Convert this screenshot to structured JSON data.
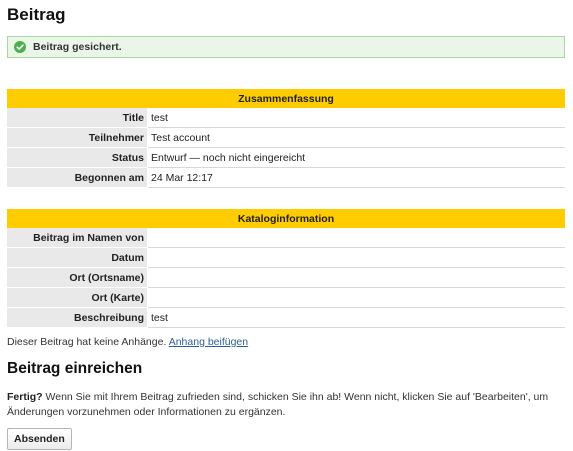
{
  "page": {
    "title": "Beitrag"
  },
  "notice": {
    "message": "Beitrag gesichert.",
    "icon": "check-circle-icon",
    "color": "#4caf50"
  },
  "summary": {
    "header": "Zusammenfassung",
    "rows": [
      {
        "label": "Title",
        "value": "test"
      },
      {
        "label": "Teilnehmer",
        "value": "Test account"
      },
      {
        "label": "Status",
        "value": "Entwurf — noch nicht eingereicht"
      },
      {
        "label": "Begonnen am",
        "value": "24 Mar 12:17"
      }
    ]
  },
  "catalog": {
    "header": "Kataloginformation",
    "rows": [
      {
        "label": "Beitrag im Namen von",
        "value": ""
      },
      {
        "label": "Datum",
        "value": ""
      },
      {
        "label": "Ort (Ortsname)",
        "value": ""
      },
      {
        "label": "Ort (Karte)",
        "value": ""
      },
      {
        "label": "Beschreibung",
        "value": "test"
      }
    ]
  },
  "attachments": {
    "text": "Dieser Beitrag hat keine Anhänge.",
    "link": "Anhang beifügen"
  },
  "submit": {
    "title": "Beitrag einreichen",
    "lead": "Fertig?",
    "text": " Wenn Sie mit Ihrem Beitrag zufrieden sind, schicken Sie ihn ab! Wenn nicht, klicken Sie auf 'Bearbeiten', um Änderungen vorzunehmen oder Informationen zu ergänzen.",
    "button_label": "Absenden"
  },
  "colors": {
    "accent": "#ffcc00",
    "label_bg": "#e9e9e9",
    "notice_bg": "#eaf7e8",
    "link": "#2a5f99"
  }
}
